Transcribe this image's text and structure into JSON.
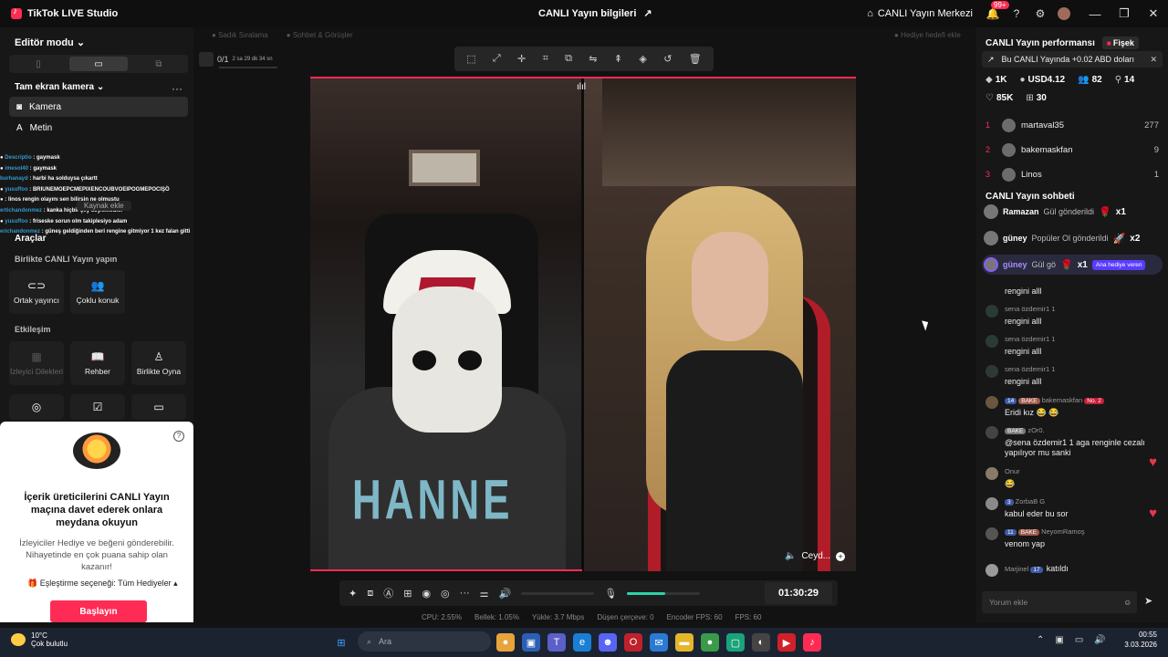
{
  "titlebar": {
    "app_title": "TikTok LIVE Studio",
    "center_title": "CANLI Yayın bilgileri",
    "live_center": "CANLI Yayın Merkezi",
    "notif_badge": "99+",
    "minimize": "—",
    "maximize": "❐",
    "close": "✕"
  },
  "left": {
    "editor_mode": "Editör modu",
    "section_camera": "Tam ekran kamera",
    "sources": [
      {
        "label": "Kamera",
        "icon": "camera-icon"
      },
      {
        "label": "Metin",
        "icon": "text-icon"
      }
    ],
    "add_source": "Kaynak ekle",
    "chat_overlay": [
      {
        "user": "Descriptio",
        "text": " : gaymask"
      },
      {
        "user": "imesol40",
        "text": " : gaymask"
      },
      {
        "user": "burhanayd",
        "text": " : harbi ha solduysa çıkartt"
      },
      {
        "user": "yusuffoo",
        "text": " : BRIUNEMOEPCMEPIXENCOUBVOEIPOGMEPOCIŞÖ"
      },
      {
        "user": "",
        "text": " : linos rengin olayını sen bilirsin ne olmuştu"
      },
      {
        "user": "ertichandonmez",
        "text": " : kanka hiçbir şey söylemedler"
      },
      {
        "user": "yusuffoo",
        "text": " : friseske sorun olm takiplesiyo adam"
      },
      {
        "user": "erichandonmez",
        "text": " : güneş geldiğinden beri rengine gitmiyor 1 kez falan gitti"
      }
    ],
    "tools_header": "Araçlar",
    "together_header": "Birlikte CANLI Yayın yapın",
    "together_tiles": [
      {
        "label": "Ortak yayıncı",
        "icon": "link-icon"
      },
      {
        "label": "Çoklu konuk",
        "icon": "group-icon"
      }
    ],
    "interaction_header": "Etkileşim",
    "interaction_tiles": [
      {
        "label": "İzleyici Dilekleri",
        "icon": "wish-icon"
      },
      {
        "label": "Rehber",
        "icon": "guide-icon"
      },
      {
        "label": "Birlikte Oyna",
        "icon": "play-together-icon"
      }
    ],
    "more_tiles": [
      {
        "icon": "poll-icon"
      },
      {
        "icon": "checklist-icon"
      },
      {
        "icon": "box-icon"
      }
    ],
    "promo": {
      "title": "İçerik üreticilerini CANLI Yayın maçına davet ederek onlara meydana okuyun",
      "desc": "İzleyiciler Hediye ve beğeni gönderebilir. Nihayetinde en çok puana sahip olan kazanır!",
      "match_option": "Eşleştirme seçeneği: Tüm Hediyeler",
      "button": "Başlayın"
    }
  },
  "center": {
    "tab_sort": "Sadık Sıralama",
    "tab_chat": "Sohbet & Görüşler",
    "gift_goal": "Hediye hedefi ekle",
    "session_count": "0/1",
    "session_time": "2 sa 29 dk 34 sn",
    "right_video_label": "Ceyd...",
    "timer": "01:30:29",
    "stats": [
      "CPU: 2.55%",
      "Bellek: 1.05%",
      "Yükle: 3.7 Mbps",
      "Düşen çerçeve: 0",
      "Encoder FPS: 60",
      "FPS: 60"
    ],
    "shirt_text": "HANNE"
  },
  "right": {
    "perf_title": "CANLI Yayın performansı",
    "fisek": "Fişek",
    "banner": "Bu CANLI Yayında +0.02 ABD doları",
    "stats": {
      "diamonds": "1K",
      "usd": "USD4.12",
      "viewers": "82",
      "follows": "14",
      "likes": "85K",
      "gifts": "30"
    },
    "ranking": [
      {
        "rank": "1",
        "name": "martaval35",
        "score": "277"
      },
      {
        "rank": "2",
        "name": "bakemaskfan",
        "score": "9"
      },
      {
        "rank": "3",
        "name": "Linos",
        "score": "1"
      }
    ],
    "chat_title": "CANLI Yayın sohbeti",
    "gifts": [
      {
        "user": "Ramazan",
        "text": "Gül gönderildi",
        "mult": "x1"
      },
      {
        "user": "güney",
        "text": "Popüler Ol gönderildi",
        "mult": "x2"
      },
      {
        "user": "güney",
        "text": "Gül gö",
        "mult": "x1",
        "tag": "Ana hediye veren"
      }
    ],
    "messages": [
      {
        "user": "",
        "text": "rengini alll"
      },
      {
        "user": "sena özdemir1 1",
        "text": "rengini alll"
      },
      {
        "user": "sena özdemir1 1",
        "text": "rengini alll"
      },
      {
        "user": "sena özdemir1 1",
        "text": "rengini alll"
      },
      {
        "lv": "14",
        "badge": "BAKE",
        "user": "bakemaskfan",
        "no": "No. 2",
        "text": "Eridi kız 😂 😂"
      },
      {
        "badge": "BAKE",
        "user": "zOr0.",
        "text": "@sena özdemir1 1 aga renginle cezalı yapılıyor mu sanki"
      },
      {
        "user": "Onur",
        "text": "😂"
      },
      {
        "lv": "3",
        "user": "ZorbaB G",
        "text": "kabul eder bu sor"
      },
      {
        "lv": "11",
        "badge": "BAKE",
        "user": "NeyomRamoş",
        "text": "venom yap"
      },
      {
        "user": "Marjinel",
        "lv": "17",
        "text": "katıldı"
      }
    ],
    "input_placeholder": "Yorum ekle"
  },
  "taskbar": {
    "temp": "10°C",
    "weather": "Çok bulutlu",
    "weather_badge": "4",
    "search": "Ara",
    "time": "00:55",
    "date": "3.03.2026"
  }
}
